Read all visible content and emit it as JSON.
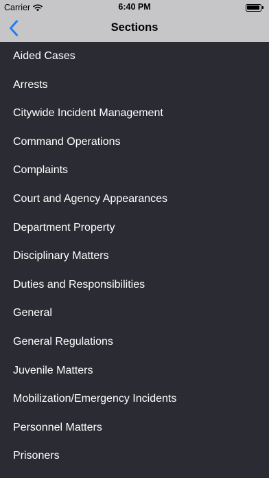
{
  "status_bar": {
    "carrier": "Carrier",
    "time": "6:40 PM",
    "wifi_icon": "wifi-icon",
    "battery_icon": "battery-icon"
  },
  "nav_bar": {
    "title": "Sections",
    "back_icon": "chevron-left-icon",
    "background_color": "#c6c6c8",
    "tint_color": "#1f7cf5"
  },
  "list": {
    "background_color": "#2b2b33",
    "text_color": "#ffffff",
    "items": [
      "Aided Cases",
      "Arrests",
      "Citywide Incident Management",
      "Command Operations",
      "Complaints",
      "Court and Agency Appearances",
      "Department Property",
      "Disciplinary Matters",
      "Duties and Responsibilities",
      "General",
      "General Regulations",
      "Juvenile Matters",
      "Mobilization/Emergency Incidents",
      "Personnel Matters",
      "Prisoners"
    ]
  }
}
